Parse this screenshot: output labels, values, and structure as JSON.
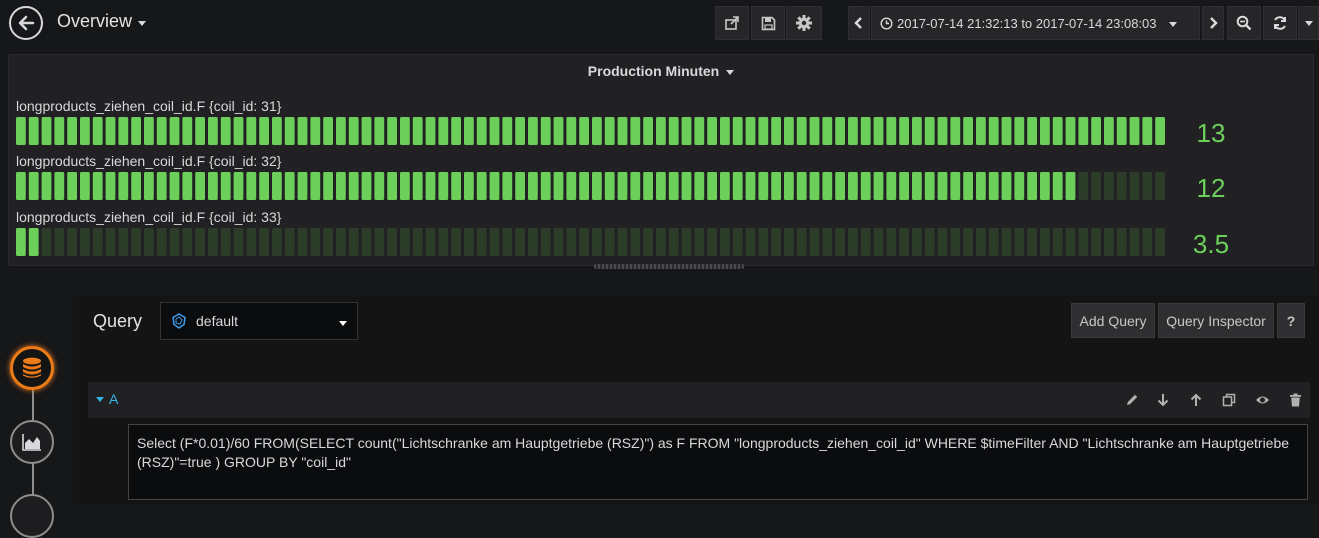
{
  "navbar": {
    "title": "Overview",
    "time_range": "2017-07-14 21:32:13 to 2017-07-14 23:08:03"
  },
  "panel": {
    "title": "Production Minuten",
    "series": [
      {
        "label": "longproducts_ziehen_coil_id.F {coil_id: 31}",
        "value": "13",
        "fraction": 1.0
      },
      {
        "label": "longproducts_ziehen_coil_id.F {coil_id: 32}",
        "value": "12",
        "fraction": 0.923
      },
      {
        "label": "longproducts_ziehen_coil_id.F {coil_id: 33}",
        "value": "3.5",
        "fraction": 0.02
      }
    ],
    "colors": {
      "lit": "#6ccf5a",
      "unlit": "#2b3d29",
      "value": "#6ccf5a"
    }
  },
  "editor": {
    "label": "Query",
    "datasource": "default",
    "add_query": "Add Query",
    "query_inspector": "Query Inspector",
    "help": "?",
    "ref_id": "A",
    "query": "Select (F*0.01)/60 FROM(SELECT count(\"Lichtschranke am Hauptgetriebe (RSZ)\") as F FROM \"longproducts_ziehen_coil_id\" WHERE $timeFilter AND \"Lichtschranke am Hauptgetriebe (RSZ)\"=true ) GROUP BY \"coil_id\""
  },
  "accent_color": "#eb7b18"
}
